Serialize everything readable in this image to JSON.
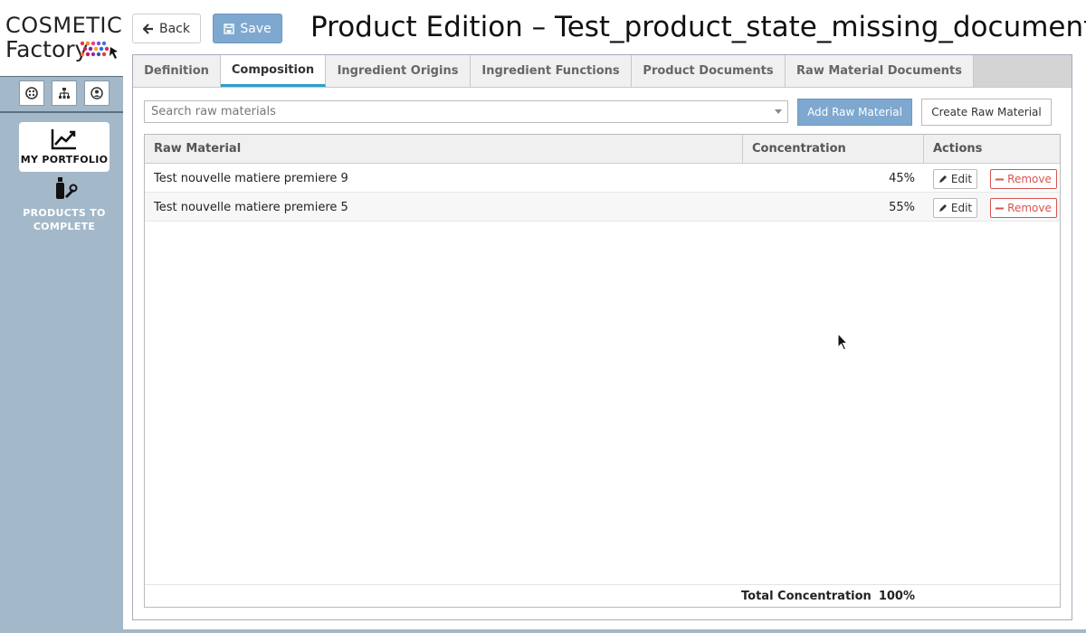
{
  "sidebar": {
    "logo": {
      "line1": "COSMETIC",
      "line2": "Factory"
    },
    "tools": [
      {
        "icon": "palette-icon"
      },
      {
        "icon": "sitemap-icon"
      },
      {
        "icon": "user-icon"
      }
    ],
    "nav": [
      {
        "label": "MY PORTFOLIO",
        "icon": "chart-line-icon",
        "active": true
      },
      {
        "label": "PRODUCTS TO COMPLETE",
        "icon": "bottle-wrench-icon",
        "active": false
      }
    ]
  },
  "header": {
    "back_label": "Back",
    "save_label": "Save",
    "title": "Product Edition – Test_product_state_missing_document"
  },
  "tabs": [
    {
      "label": "Definition",
      "active": false
    },
    {
      "label": "Composition",
      "active": true
    },
    {
      "label": "Ingredient Origins",
      "active": false
    },
    {
      "label": "Ingredient Functions",
      "active": false
    },
    {
      "label": "Product Documents",
      "active": false
    },
    {
      "label": "Raw Material Documents",
      "active": false
    }
  ],
  "composition": {
    "search_placeholder": "Search raw materials",
    "add_label": "Add Raw Material",
    "create_label": "Create Raw Material",
    "columns": [
      "Raw Material",
      "Concentration",
      "Actions"
    ],
    "rows": [
      {
        "name": "Test nouvelle matiere premiere 9",
        "concentration": "45%",
        "edit": "Edit",
        "remove": "Remove"
      },
      {
        "name": "Test nouvelle matiere premiere 5",
        "concentration": "55%",
        "edit": "Edit",
        "remove": "Remove"
      }
    ],
    "total_label": "Total Concentration",
    "total_value": "100%"
  },
  "colors": {
    "sidebar": "#a3b8c9",
    "primary_button": "#7ea8cf",
    "active_tab_underline": "#2aa0c8",
    "danger": "#d9534f"
  }
}
